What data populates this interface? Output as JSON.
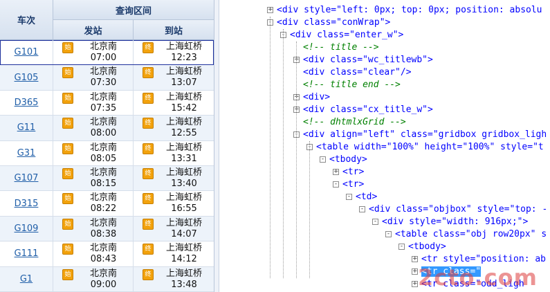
{
  "table": {
    "header_train": "车次",
    "header_range": "查询区间",
    "header_from": "发站",
    "header_to": "到站",
    "start_badge": "始",
    "end_badge": "终",
    "rows": [
      {
        "train": "G101",
        "from": "北京南",
        "dep": "07:00",
        "to": "上海虹桥",
        "arr": "12:23"
      },
      {
        "train": "G105",
        "from": "北京南",
        "dep": "07:30",
        "to": "上海虹桥",
        "arr": "13:07"
      },
      {
        "train": "D365",
        "from": "北京南",
        "dep": "07:35",
        "to": "上海虹桥",
        "arr": "15:42"
      },
      {
        "train": "G11",
        "from": "北京南",
        "dep": "08:00",
        "to": "上海虹桥",
        "arr": "12:55"
      },
      {
        "train": "G31",
        "from": "北京南",
        "dep": "08:05",
        "to": "上海虹桥",
        "arr": "13:31"
      },
      {
        "train": "G107",
        "from": "北京南",
        "dep": "08:15",
        "to": "上海虹桥",
        "arr": "13:40"
      },
      {
        "train": "D315",
        "from": "北京南",
        "dep": "08:22",
        "to": "上海虹桥",
        "arr": "16:55"
      },
      {
        "train": "G109",
        "from": "北京南",
        "dep": "08:38",
        "to": "上海虹桥",
        "arr": "14:07"
      },
      {
        "train": "G111",
        "from": "北京南",
        "dep": "08:43",
        "to": "上海虹桥",
        "arr": "14:12"
      },
      {
        "train": "G1",
        "from": "北京南",
        "dep": "09:00",
        "to": "上海虹桥",
        "arr": "13:48"
      }
    ]
  },
  "code_tree": [
    {
      "text": "<div style=\"left: 0px; top: 0px; position: absolu",
      "kind": "tag",
      "toggle": "+"
    },
    {
      "text": "<div class=\"conWrap\">",
      "kind": "tag",
      "toggle": "-"
    },
    {
      "text": "<div class=\"enter_w\">",
      "kind": "tag",
      "toggle": "-"
    },
    {
      "text": "<!-- title  -->",
      "kind": "cmt",
      "toggle": ""
    },
    {
      "text": "<div class=\"wc_titlewb\">",
      "kind": "tag",
      "toggle": "+"
    },
    {
      "text": "<div class=\"clear\"/>",
      "kind": "tag",
      "toggle": ""
    },
    {
      "text": "<!-- title end -->",
      "kind": "cmt",
      "toggle": ""
    },
    {
      "text": "<div>",
      "kind": "tag",
      "toggle": "+"
    },
    {
      "text": "<div class=\"cx_title_w\">",
      "kind": "tag",
      "toggle": "+"
    },
    {
      "text": "<!--  dhtmlxGrid  -->",
      "kind": "cmt",
      "toggle": ""
    },
    {
      "text": "<div align=\"left\" class=\"gridbox gridbox_ligh",
      "kind": "tag",
      "toggle": "-"
    },
    {
      "text": "<table width=\"100%\" height=\"100%\" style=\"t",
      "kind": "tag",
      "toggle": "-"
    },
    {
      "text": "<tbody>",
      "kind": "tag",
      "toggle": "-"
    },
    {
      "text": "<tr>",
      "kind": "tag",
      "toggle": "+"
    },
    {
      "text": "<tr>",
      "kind": "tag",
      "toggle": "-"
    },
    {
      "text": "<td>",
      "kind": "tag",
      "toggle": "-"
    },
    {
      "text": "<div class=\"objbox\" style=\"top: -",
      "kind": "tag",
      "toggle": "-"
    },
    {
      "text": "<div style=\"width: 916px;\">",
      "kind": "tag",
      "toggle": "-"
    },
    {
      "text": "<table class=\"obj row20px\" s",
      "kind": "tag",
      "toggle": "-"
    },
    {
      "text": "<tbody>",
      "kind": "tag",
      "toggle": "-"
    },
    {
      "text": "<tr style=\"position: ab",
      "kind": "tag",
      "toggle": "+"
    },
    {
      "text": "<tr class=\"",
      "kind": "tag",
      "toggle": "+",
      "highlight": true
    },
    {
      "text": "<tr class=\"odd_ligh",
      "kind": "tag",
      "toggle": "+"
    }
  ],
  "watermark": "2cto.com"
}
